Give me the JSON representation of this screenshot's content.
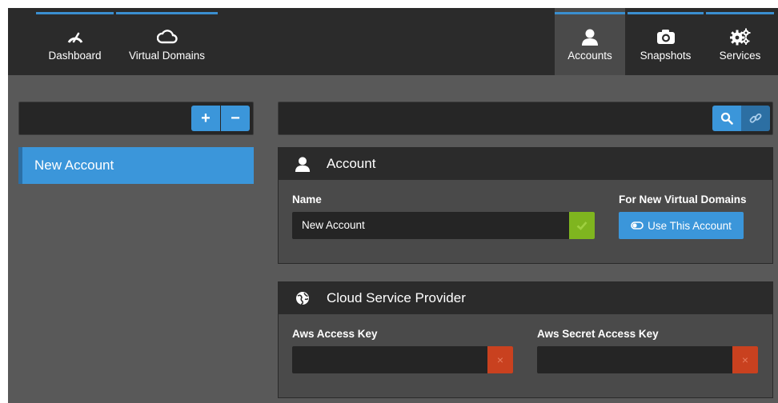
{
  "nav": {
    "left": [
      {
        "label": "Dashboard",
        "icon": "speedometer-icon"
      },
      {
        "label": "Virtual Domains",
        "icon": "cloud-icon"
      }
    ],
    "right": [
      {
        "label": "Accounts",
        "icon": "user-icon",
        "active": true
      },
      {
        "label": "Snapshots",
        "icon": "camera-icon"
      },
      {
        "label": "Services",
        "icon": "gears-icon"
      }
    ]
  },
  "sidebar": {
    "add_label": "+",
    "remove_label": "−",
    "items": [
      {
        "label": "New Account",
        "selected": true
      }
    ]
  },
  "account_panel": {
    "title": "Account",
    "name_label": "Name",
    "name_value": "New Account",
    "for_new_label": "For New Virtual Domains",
    "use_button_label": "Use This Account"
  },
  "provider_panel": {
    "title": "Cloud Service Provider",
    "access_key_label": "Aws Access Key",
    "access_key_value": "",
    "secret_key_label": "Aws Secret Access Key",
    "secret_key_value": "",
    "error_mark": "×"
  },
  "colors": {
    "accent": "#3b96da",
    "valid": "#7fb51f",
    "error": "#c9411f",
    "nav_bg": "#2b2b2b",
    "page_bg": "#595959"
  }
}
